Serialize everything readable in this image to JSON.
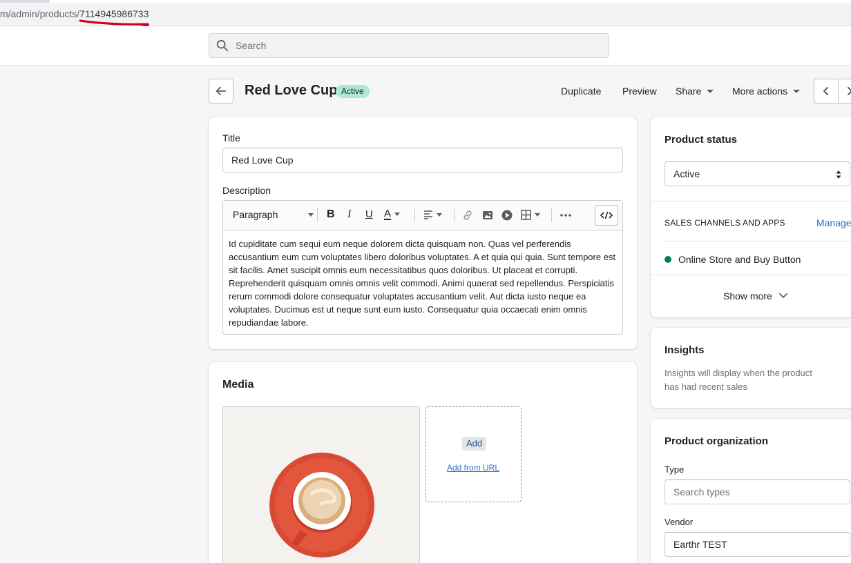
{
  "browser": {
    "url_prefix": "m/admin/products/",
    "url_id": "7114945986733"
  },
  "topbar": {
    "search_placeholder": "Search"
  },
  "header": {
    "title": "Red Love Cup",
    "status_badge": "Active",
    "actions": {
      "duplicate": "Duplicate",
      "preview": "Preview",
      "share": "Share",
      "more_actions": "More actions"
    }
  },
  "details": {
    "title_label": "Title",
    "title_value": "Red Love Cup",
    "description_label": "Description",
    "toolbar": {
      "paragraph": "Paragraph"
    },
    "description_text": "Id cupiditate cum sequi eum neque dolorem dicta quisquam non. Quas vel perferendis accusantium eum cum voluptates libero doloribus voluptates. A et quia qui quia. Sunt tempore est sit facilis. Amet suscipit omnis eum necessitatibus quos doloribus. Ut placeat et corrupti. Reprehenderit quisquam omnis omnis velit commodi. Animi quaerat sed repellendus. Perspiciatis rerum commodi dolore consequatur voluptates accusantium velit. Aut dicta iusto neque ea voluptates. Ducimus est ut neque sunt eum iusto. Consequatur quia occaecati enim omnis repudiandae labore."
  },
  "media": {
    "heading": "Media",
    "add_button": "Add",
    "add_from_url": "Add from URL"
  },
  "product_status": {
    "heading": "Product status",
    "selected": "Active",
    "sales_channels_heading": "SALES CHANNELS AND APPS",
    "manage_link": "Manage",
    "channel": "Online Store and Buy Button",
    "show_more": "Show more"
  },
  "insights": {
    "heading": "Insights",
    "text_line1": "Insights will display when the product",
    "text_line2": "has had recent sales"
  },
  "organization": {
    "heading": "Product organization",
    "type_label": "Type",
    "type_placeholder": "Search types",
    "vendor_label": "Vendor",
    "vendor_value": "Earthr TEST"
  },
  "colors": {
    "accent_link": "#2c6ecb",
    "badge_bg": "#aee9d1",
    "channel_dot": "#007f5f",
    "annotation_red": "#d0021b"
  }
}
